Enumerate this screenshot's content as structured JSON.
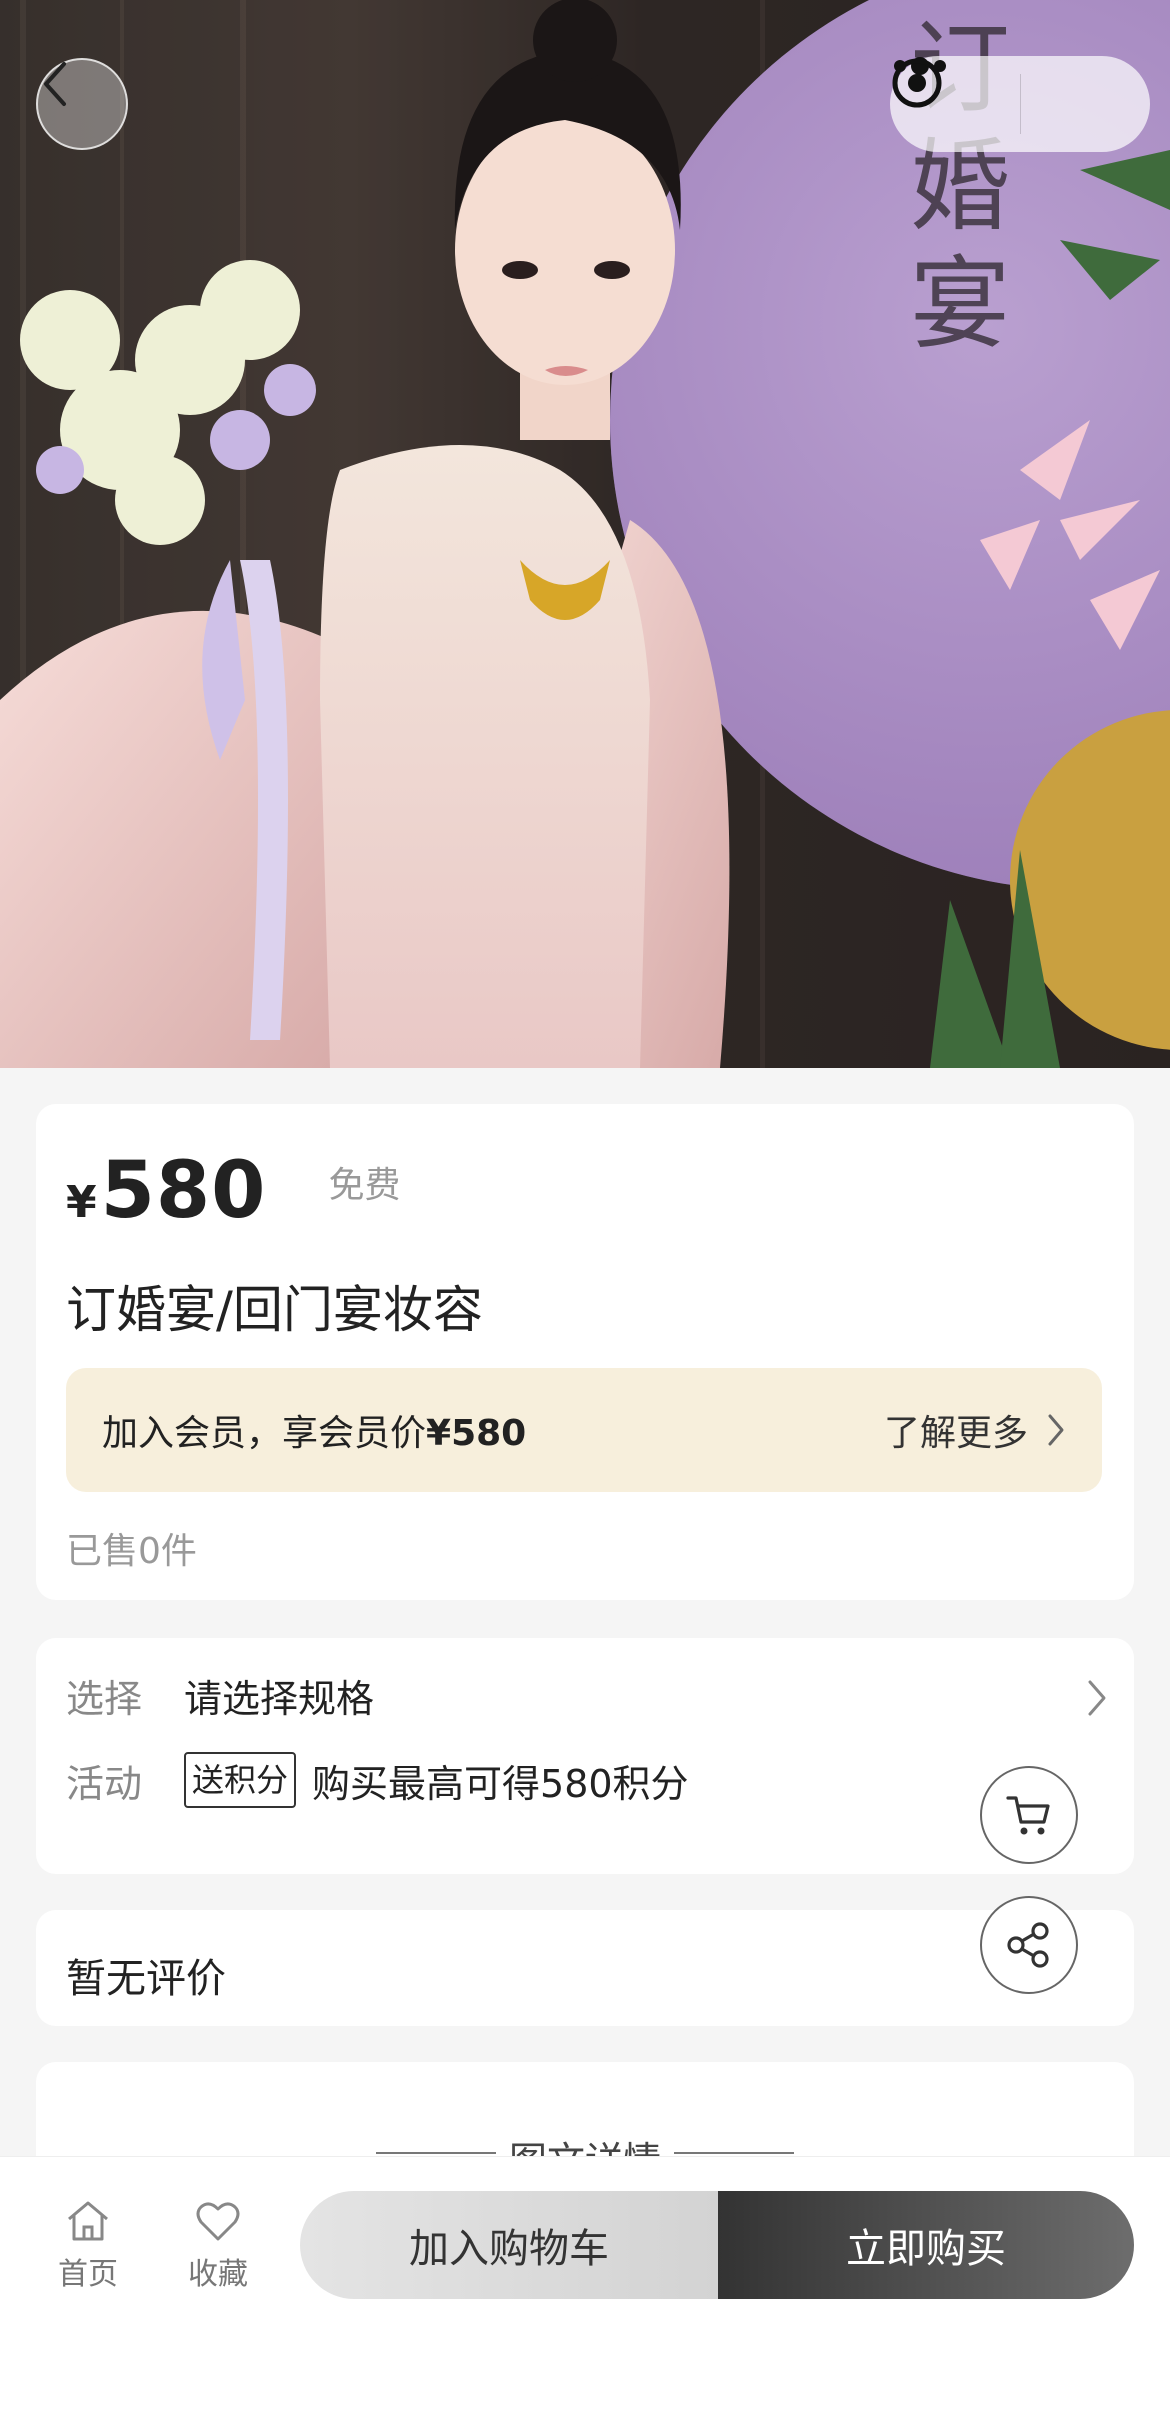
{
  "hero": {
    "sign_text": "订婚宴",
    "image_alt": "product-photo"
  },
  "nav": {
    "back_icon": "chevron-left-icon",
    "more_icon": "more-dots-icon",
    "close_icon": "target-close-icon"
  },
  "price": {
    "currency": "¥",
    "value": "580",
    "tag": "免费"
  },
  "product": {
    "title": "订婚宴/回门宴妆容"
  },
  "member": {
    "text_prefix": "加入会员，享会员价",
    "price": "¥580",
    "more": "了解更多"
  },
  "sold": "已售0件",
  "spec": {
    "label": "选择",
    "value": "请选择规格"
  },
  "activity": {
    "label": "活动",
    "badge": "送积分",
    "text": "购买最高可得580积分"
  },
  "review": {
    "text": "暂无评价"
  },
  "detail": {
    "title": "图文详情"
  },
  "tabs": [
    {
      "label": "首页",
      "icon": "home-icon"
    },
    {
      "label": "收藏",
      "icon": "heart-icon"
    }
  ],
  "actions": {
    "add_to_cart": "加入购物车",
    "buy_now": "立即购买"
  },
  "colors": {
    "member_bg": "#f7efdc",
    "buy_dark": "#333333",
    "cart_grey": "#dcdcdc"
  }
}
